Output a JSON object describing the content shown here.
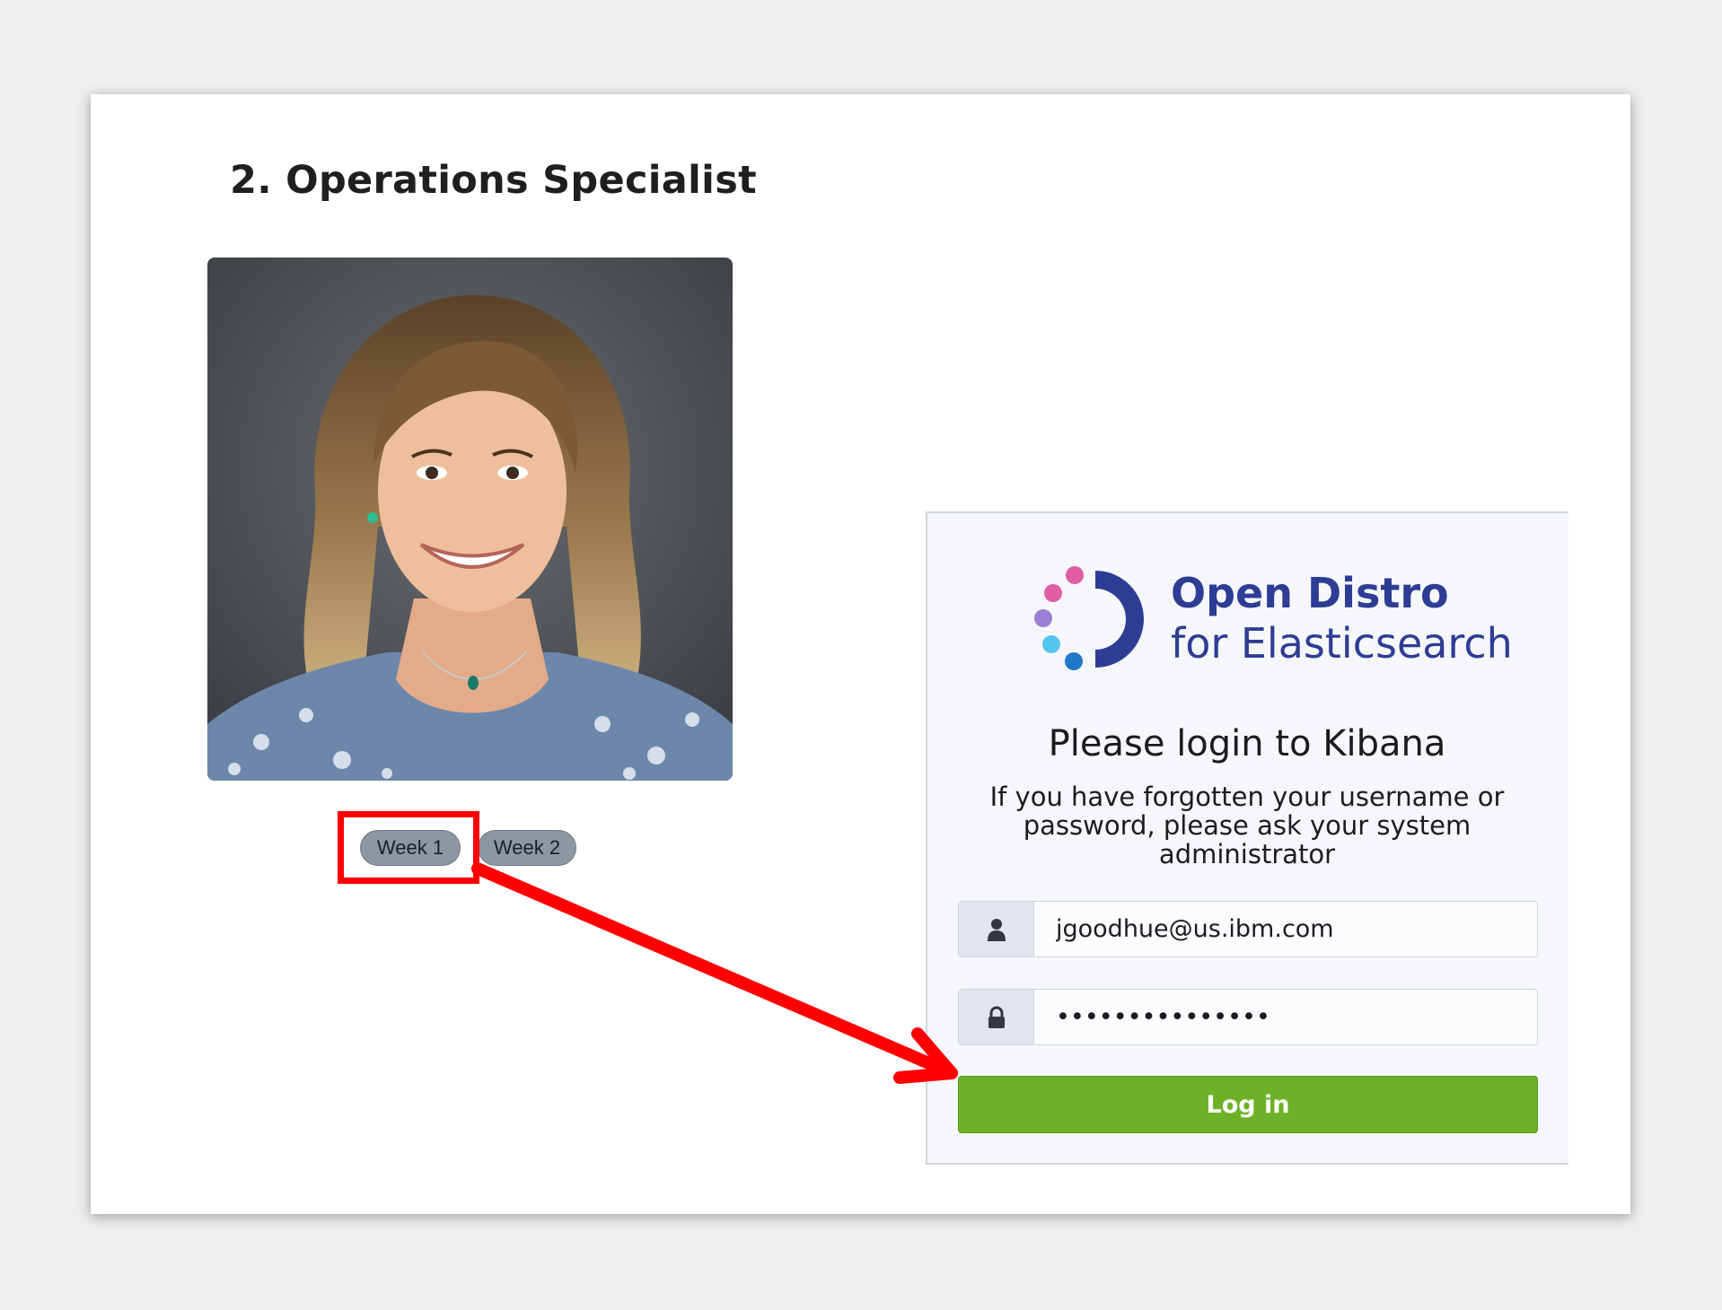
{
  "page": {
    "title": "2. Operations Specialist"
  },
  "tabs": [
    {
      "label": "Week 1"
    },
    {
      "label": "Week 2"
    }
  ],
  "login": {
    "brand_line1": "Open Distro",
    "brand_line2": "for Elasticsearch",
    "heading": "Please login to Kibana",
    "subtext": "If you have forgotten your username or password, please ask your system administrator",
    "username_value": "jgoodhue@us.ibm.com",
    "password_masked": "•••••••••••••••",
    "login_button": "Log in"
  },
  "colors": {
    "highlight": "#ff0000",
    "login_button": "#6db226",
    "brand": "#2e3d94"
  },
  "icons": {
    "username": "user-icon",
    "password": "lock-icon",
    "logo": "open-distro-logo"
  }
}
